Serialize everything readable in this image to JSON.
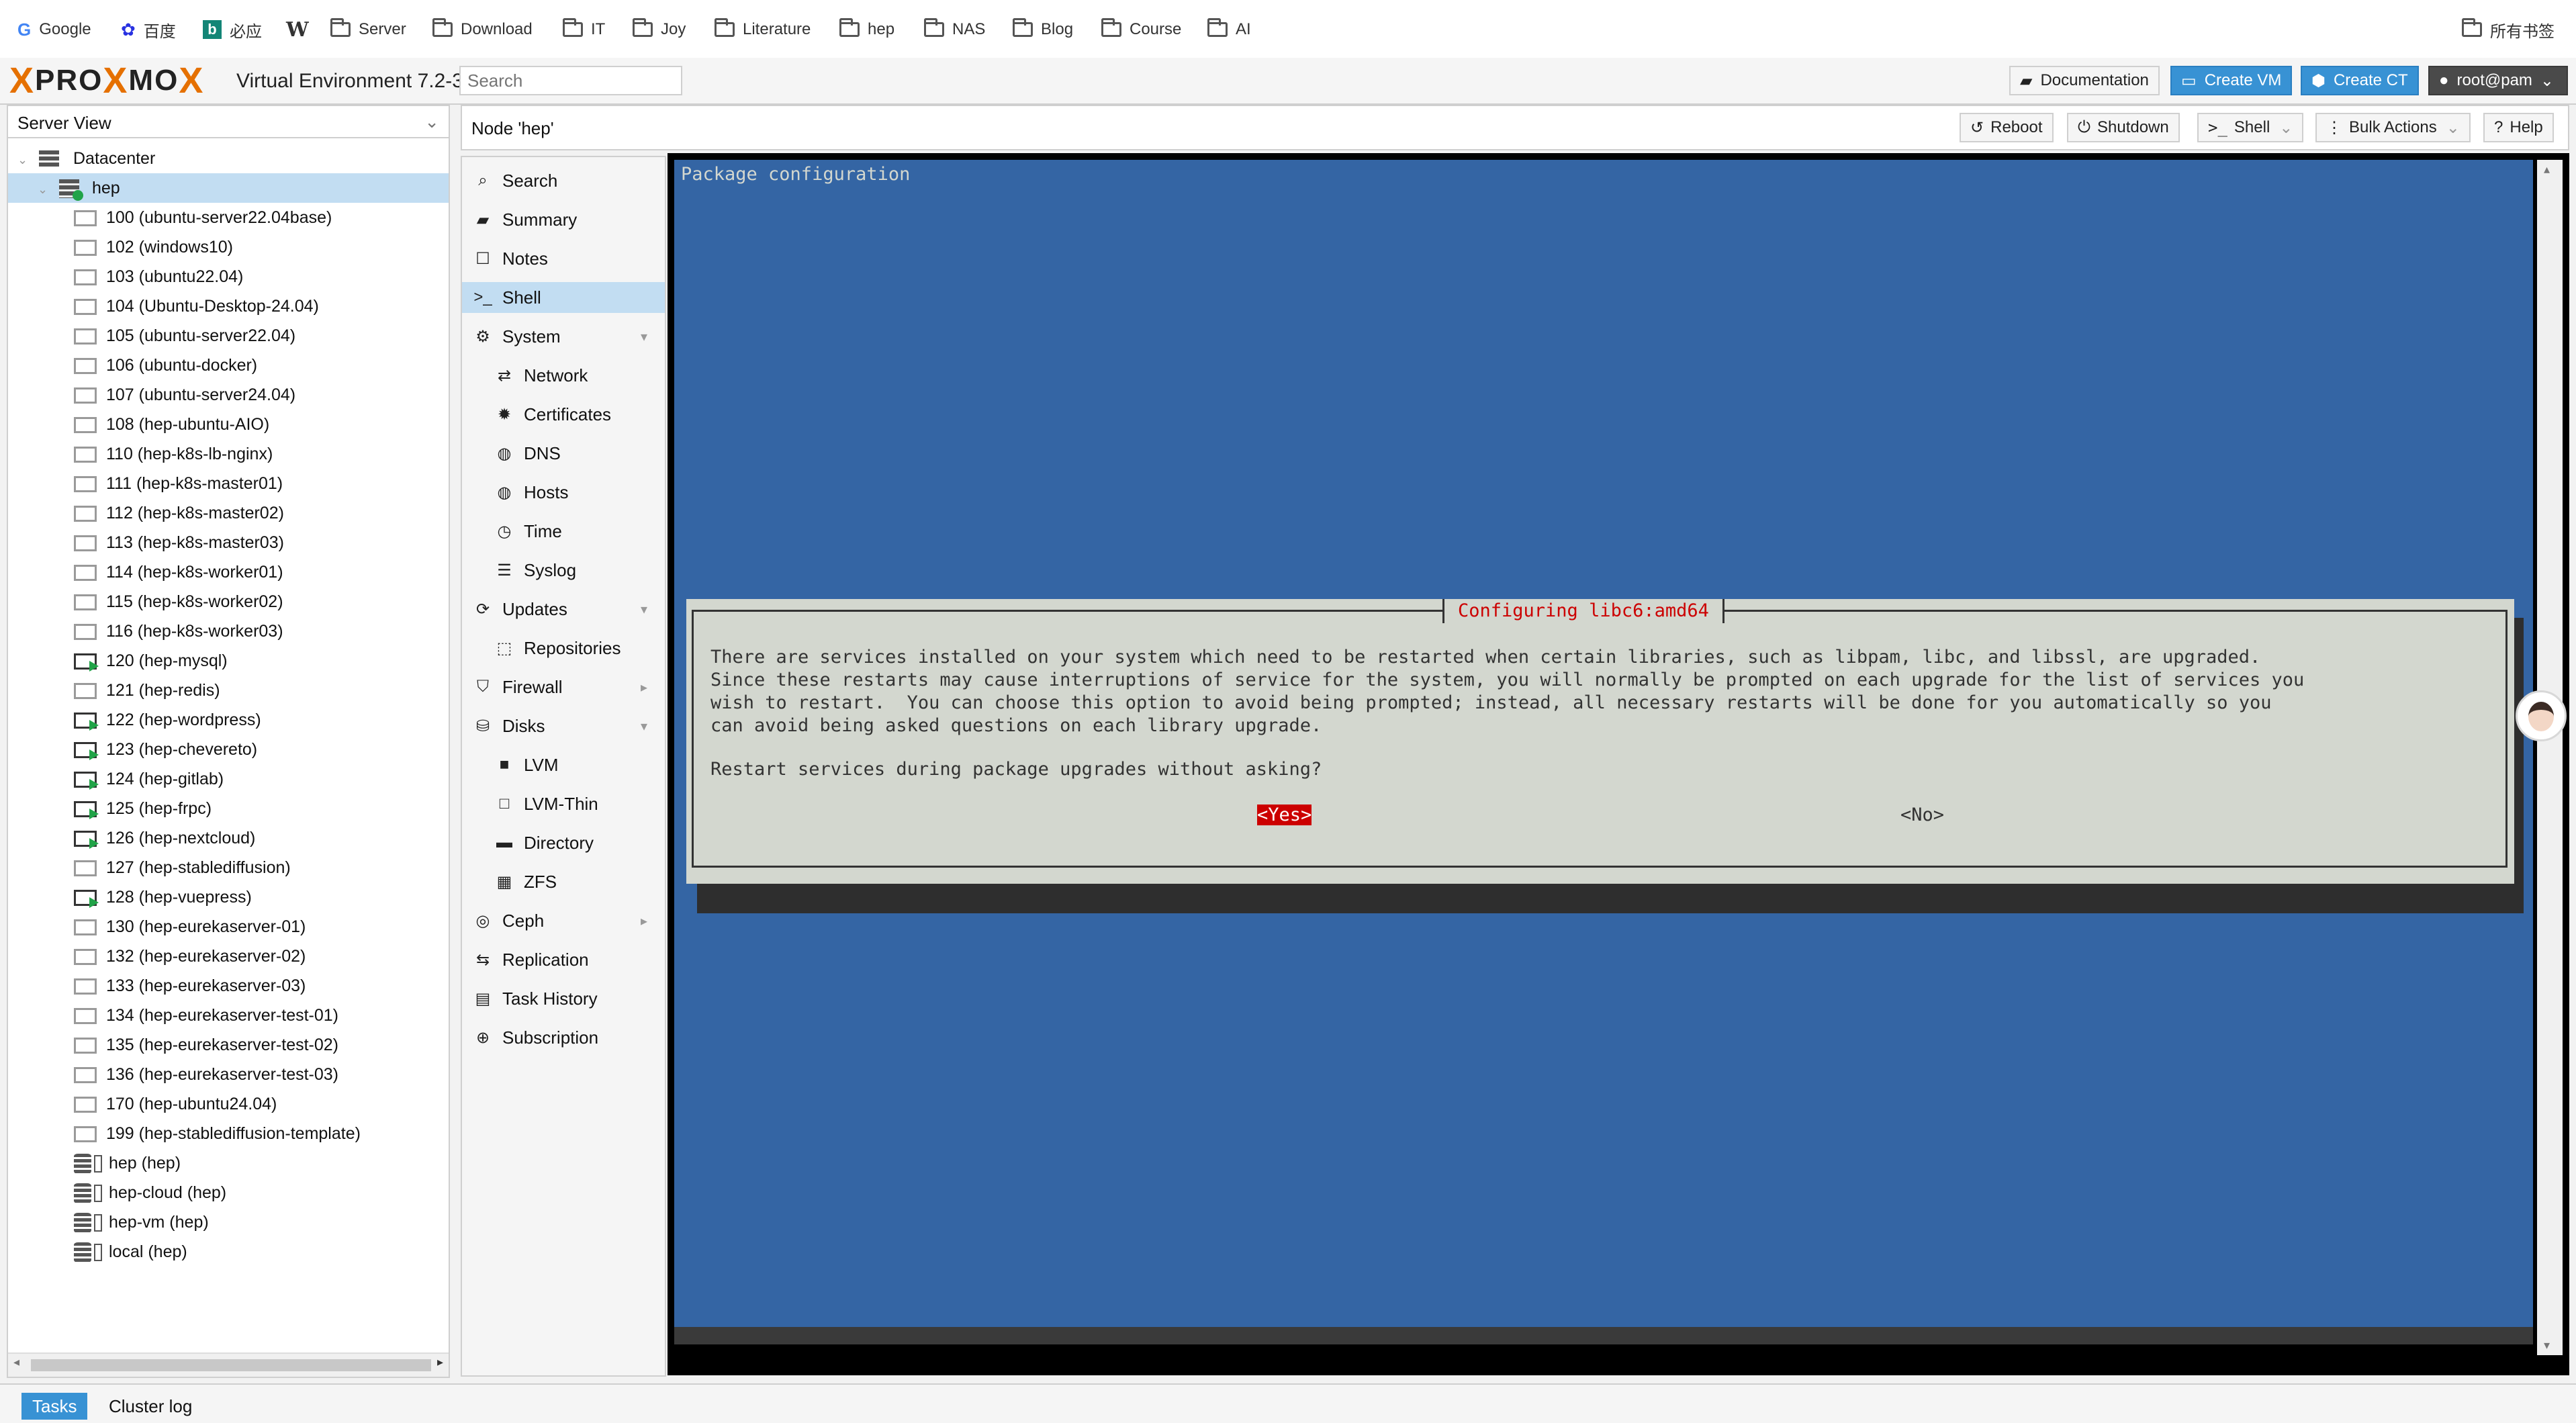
{
  "bookmarks": [
    {
      "label": "Google",
      "icon": "google-icon"
    },
    {
      "label": "百度",
      "icon": "baidu-icon"
    },
    {
      "label": "必应",
      "icon": "bing-icon"
    },
    {
      "label": "",
      "icon": "wikipedia-icon"
    },
    {
      "label": "Server",
      "icon": "folder-icon"
    },
    {
      "label": "Download",
      "icon": "folder-icon"
    },
    {
      "label": "IT",
      "icon": "folder-icon"
    },
    {
      "label": "Joy",
      "icon": "folder-icon"
    },
    {
      "label": "Literature",
      "icon": "folder-icon"
    },
    {
      "label": "hep",
      "icon": "folder-icon"
    },
    {
      "label": "NAS",
      "icon": "folder-icon"
    },
    {
      "label": "Blog",
      "icon": "folder-icon"
    },
    {
      "label": "Course",
      "icon": "folder-icon"
    },
    {
      "label": "AI",
      "icon": "folder-icon"
    }
  ],
  "all_bookmarks_label": "所有书签",
  "header": {
    "logo_x1": "X",
    "logo_word1": "PRO",
    "logo_x2": "X",
    "logo_word2": "MO",
    "logo_x3": "X",
    "version": "Virtual Environment 7.2-3",
    "search_placeholder": "Search",
    "documentation": "Documentation",
    "create_vm": "Create VM",
    "create_ct": "Create CT",
    "user": "root@pam"
  },
  "tree": {
    "view": "Server View",
    "datacenter": "Datacenter",
    "node": "hep",
    "guests": [
      {
        "label": "100 (ubuntu-server22.04base)",
        "running": false
      },
      {
        "label": "102 (windows10)",
        "running": false
      },
      {
        "label": "103 (ubuntu22.04)",
        "running": false
      },
      {
        "label": "104 (Ubuntu-Desktop-24.04)",
        "running": false
      },
      {
        "label": "105 (ubuntu-server22.04)",
        "running": false
      },
      {
        "label": "106 (ubuntu-docker)",
        "running": false
      },
      {
        "label": "107 (ubuntu-server24.04)",
        "running": false
      },
      {
        "label": "108 (hep-ubuntu-AIO)",
        "running": false
      },
      {
        "label": "110 (hep-k8s-lb-nginx)",
        "running": false
      },
      {
        "label": "111 (hep-k8s-master01)",
        "running": false
      },
      {
        "label": "112 (hep-k8s-master02)",
        "running": false
      },
      {
        "label": "113 (hep-k8s-master03)",
        "running": false
      },
      {
        "label": "114 (hep-k8s-worker01)",
        "running": false
      },
      {
        "label": "115 (hep-k8s-worker02)",
        "running": false
      },
      {
        "label": "116 (hep-k8s-worker03)",
        "running": false
      },
      {
        "label": "120 (hep-mysql)",
        "running": true
      },
      {
        "label": "121 (hep-redis)",
        "running": false
      },
      {
        "label": "122 (hep-wordpress)",
        "running": true
      },
      {
        "label": "123 (hep-chevereto)",
        "running": true
      },
      {
        "label": "124 (hep-gitlab)",
        "running": true
      },
      {
        "label": "125 (hep-frpc)",
        "running": true
      },
      {
        "label": "126 (hep-nextcloud)",
        "running": true
      },
      {
        "label": "127 (hep-stablediffusion)",
        "running": false
      },
      {
        "label": "128 (hep-vuepress)",
        "running": true
      },
      {
        "label": "130 (hep-eurekaserver-01)",
        "running": false
      },
      {
        "label": "132 (hep-eurekaserver-02)",
        "running": false
      },
      {
        "label": "133 (hep-eurekaserver-03)",
        "running": false
      },
      {
        "label": "134 (hep-eurekaserver-test-01)",
        "running": false
      },
      {
        "label": "135 (hep-eurekaserver-test-02)",
        "running": false
      },
      {
        "label": "136 (hep-eurekaserver-test-03)",
        "running": false
      },
      {
        "label": "170 (hep-ubuntu24.04)",
        "running": false
      },
      {
        "label": "199 (hep-stablediffusion-template)",
        "running": false
      }
    ],
    "storages": [
      "hep (hep)",
      "hep-cloud (hep)",
      "hep-vm (hep)",
      "local (hep)"
    ]
  },
  "content": {
    "title": "Node 'hep'",
    "toolbar": {
      "reboot": "Reboot",
      "shutdown": "Shutdown",
      "shell": "Shell",
      "bulk_actions": "Bulk Actions",
      "help": "Help"
    }
  },
  "nav": [
    {
      "label": "Search",
      "icon": "search-icon",
      "glyph": "⌕"
    },
    {
      "label": "Summary",
      "icon": "book-icon",
      "glyph": "▰"
    },
    {
      "label": "Notes",
      "icon": "notes-icon",
      "glyph": "☐"
    },
    {
      "label": "Shell",
      "icon": "terminal-icon",
      "glyph": ">_"
    },
    {
      "label": "System",
      "icon": "gears-icon",
      "glyph": "⚙"
    },
    {
      "label": "Network",
      "icon": "network-icon",
      "glyph": "⇄"
    },
    {
      "label": "Certificates",
      "icon": "certificate-icon",
      "glyph": "✹"
    },
    {
      "label": "DNS",
      "icon": "globe-icon",
      "glyph": "◍"
    },
    {
      "label": "Hosts",
      "icon": "globe-icon",
      "glyph": "◍"
    },
    {
      "label": "Time",
      "icon": "clock-icon",
      "glyph": "◷"
    },
    {
      "label": "Syslog",
      "icon": "list-icon",
      "glyph": "☰"
    },
    {
      "label": "Updates",
      "icon": "refresh-icon",
      "glyph": "⟳"
    },
    {
      "label": "Repositories",
      "icon": "box-icon",
      "glyph": "⬚"
    },
    {
      "label": "Firewall",
      "icon": "shield-icon",
      "glyph": "⛉"
    },
    {
      "label": "Disks",
      "icon": "hdd-icon",
      "glyph": "⛁"
    },
    {
      "label": "LVM",
      "icon": "lvm-icon",
      "glyph": "■"
    },
    {
      "label": "LVM-Thin",
      "icon": "lvm-thin-icon",
      "glyph": "□"
    },
    {
      "label": "Directory",
      "icon": "folder-icon",
      "glyph": "▬"
    },
    {
      "label": "ZFS",
      "icon": "zfs-icon",
      "glyph": "▦"
    },
    {
      "label": "Ceph",
      "icon": "ceph-icon",
      "glyph": "◎"
    },
    {
      "label": "Replication",
      "icon": "replication-icon",
      "glyph": "⇆"
    },
    {
      "label": "Task History",
      "icon": "task-history-icon",
      "glyph": "▤"
    },
    {
      "label": "Subscription",
      "icon": "support-icon",
      "glyph": "⊕"
    }
  ],
  "terminal": {
    "header": "Package configuration",
    "dialog_title": "Configuring libc6:amd64",
    "dialog_lines": [
      "There are services installed on your system which need to be restarted when certain libraries, such as libpam, libc, and libssl, are upgraded.",
      "Since these restarts may cause interruptions of service for the system, you will normally be prompted on each upgrade for the list of services you",
      "wish to restart.  You can choose this option to avoid being prompted; instead, all necessary restarts will be done for you automatically so you",
      "can avoid being asked questions on each library upgrade."
    ],
    "question": "Restart services during package upgrades without asking?",
    "yes": "<Yes>",
    "no": "<No>"
  },
  "bottom": {
    "tasks": "Tasks",
    "cluster_log": "Cluster log"
  },
  "colors": {
    "accent": "#3892d4",
    "terminal_bg": "#3465a4",
    "dialog_bg": "#d3d7cf",
    "dialog_title": "#cc0000",
    "running": "#21a348",
    "logo_orange": "#e57000"
  }
}
